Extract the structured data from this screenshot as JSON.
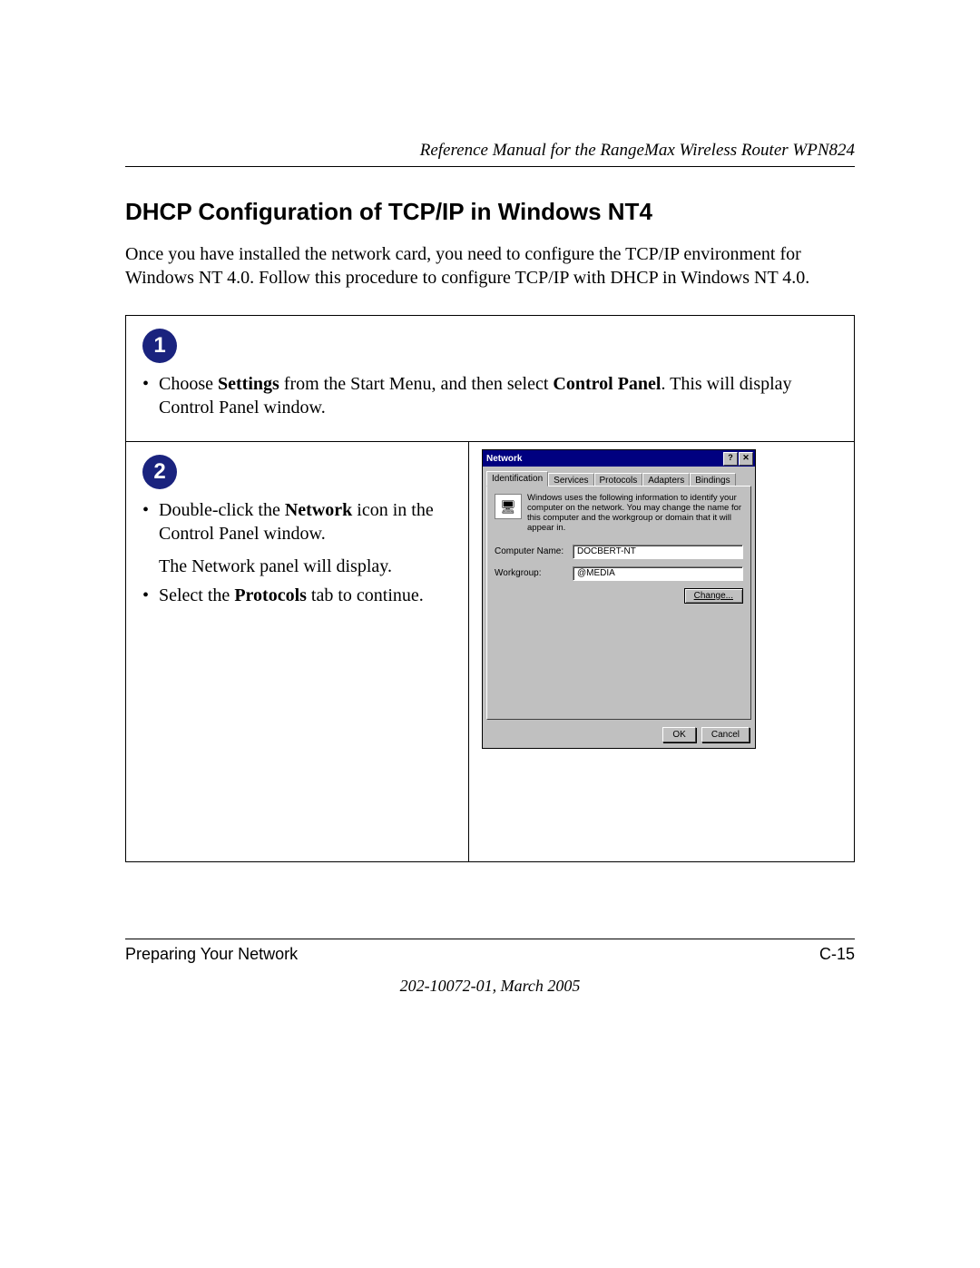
{
  "header": {
    "running_head": "Reference Manual for the RangeMax Wireless Router WPN824"
  },
  "section": {
    "title": "DHCP Configuration of TCP/IP in Windows NT4",
    "intro": "Once you have installed the network card, you need to configure the TCP/IP environment for Windows NT 4.0. Follow this procedure to configure TCP/IP with DHCP in Windows NT 4.0."
  },
  "steps": {
    "s1": {
      "num": "1",
      "bullet_pre": "Choose ",
      "bullet_b1": "Settings",
      "bullet_mid": " from the Start Menu, and then select ",
      "bullet_b2": "Control Panel",
      "bullet_post": ". This will display Control Panel window."
    },
    "s2": {
      "num": "2",
      "b1_pre": "Double-click the ",
      "b1_bold": "Network",
      "b1_post": " icon in the Control Panel window.",
      "after1": "The Network panel will display.",
      "b2_pre": "Select the ",
      "b2_bold": "Protocols",
      "b2_post": " tab to continue."
    }
  },
  "dialog": {
    "title": "Network",
    "help_btn": "?",
    "close_btn": "✕",
    "tabs": {
      "t0": "Identification",
      "t1": "Services",
      "t2": "Protocols",
      "t3": "Adapters",
      "t4": "Bindings"
    },
    "desc": "Windows uses the following information to identify your computer on the network. You may change the name for this computer and the workgroup or domain that it will appear in.",
    "computer_label": "Computer Name:",
    "computer_value": "DOCBERT-NT",
    "workgroup_label": "Workgroup:",
    "workgroup_value": "@MEDIA",
    "change_btn": "Change...",
    "ok_btn": "OK",
    "cancel_btn": "Cancel"
  },
  "footer": {
    "left": "Preparing Your Network",
    "right": "C-15",
    "sub": "202-10072-01, March 2005"
  }
}
